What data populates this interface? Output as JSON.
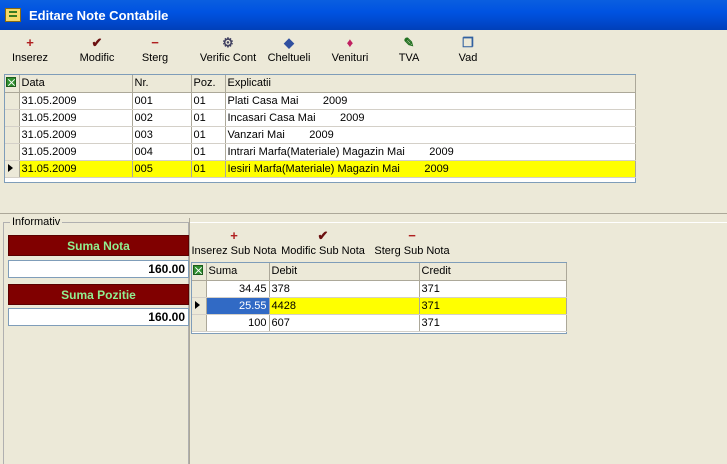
{
  "window": {
    "title": "Editare Note Contabile"
  },
  "toolbar": [
    {
      "label": "Inserez",
      "icon": "+",
      "color": "#b02020",
      "name": "inserez-button",
      "iconName": "plus-icon"
    },
    {
      "label": "Modific",
      "icon": "✔",
      "color": "#6b1010",
      "name": "modific-button",
      "iconName": "checkmark-icon"
    },
    {
      "label": "Sterg",
      "icon": "−",
      "color": "#b02020",
      "name": "sterg-button",
      "iconName": "minus-icon"
    },
    {
      "label": "Verific Cont",
      "icon": "⚙",
      "color": "#404060",
      "name": "verific-cont-button",
      "iconName": "check-account-icon"
    },
    {
      "label": "Cheltueli",
      "icon": "◆",
      "color": "#3050a0",
      "name": "cheltueli-button",
      "iconName": "expenses-icon"
    },
    {
      "label": "Venituri",
      "icon": "♦",
      "color": "#c02060",
      "name": "venituri-button",
      "iconName": "income-icon"
    },
    {
      "label": "TVA",
      "icon": "✎",
      "color": "#207020",
      "name": "tva-button",
      "iconName": "pen-icon"
    },
    {
      "label": "Vad",
      "icon": "❐",
      "color": "#3060a0",
      "name": "vad-button",
      "iconName": "view-icon"
    }
  ],
  "notes": {
    "columns": [
      "Data",
      "Nr.",
      "Poz.",
      "Explicatii"
    ],
    "rows": [
      [
        "31.05.2009",
        "001",
        "01",
        "Plati Casa Mai        2009"
      ],
      [
        "31.05.2009",
        "002",
        "01",
        "Incasari Casa Mai        2009"
      ],
      [
        "31.05.2009",
        "003",
        "01",
        "Vanzari Mai        2009"
      ],
      [
        "31.05.2009",
        "004",
        "01",
        "Intrari Marfa(Materiale) Magazin Mai        2009"
      ],
      [
        "31.05.2009",
        "005",
        "01",
        "Iesiri Marfa(Materiale) Magazin Mai        2009"
      ]
    ],
    "selected": 4
  },
  "info": {
    "legend": "Informativ",
    "suma_nota_label": "Suma Nota",
    "suma_nota_value": "160.00",
    "suma_pozitie_label": "Suma Pozitie",
    "suma_pozitie_value": "160.00"
  },
  "subtoolbar": [
    {
      "label": "Inserez Sub Nota",
      "icon": "+",
      "color": "#b02020",
      "name": "inserez-sub-nota-button",
      "iconName": "plus-icon"
    },
    {
      "label": "Modific Sub Nota",
      "icon": "✔",
      "color": "#6b1010",
      "name": "modific-sub-nota-button",
      "iconName": "checkmark-icon"
    },
    {
      "label": "Sterg Sub Nota",
      "icon": "−",
      "color": "#b02020",
      "name": "sterg-sub-nota-button",
      "iconName": "minus-icon"
    }
  ],
  "subnotes": {
    "columns": [
      "Suma",
      "Debit",
      "Credit"
    ],
    "rows": [
      [
        "34.45",
        "378",
        "371"
      ],
      [
        "25.55",
        "4428",
        "371"
      ],
      [
        "100",
        "607",
        "371"
      ]
    ],
    "selected": 1
  }
}
